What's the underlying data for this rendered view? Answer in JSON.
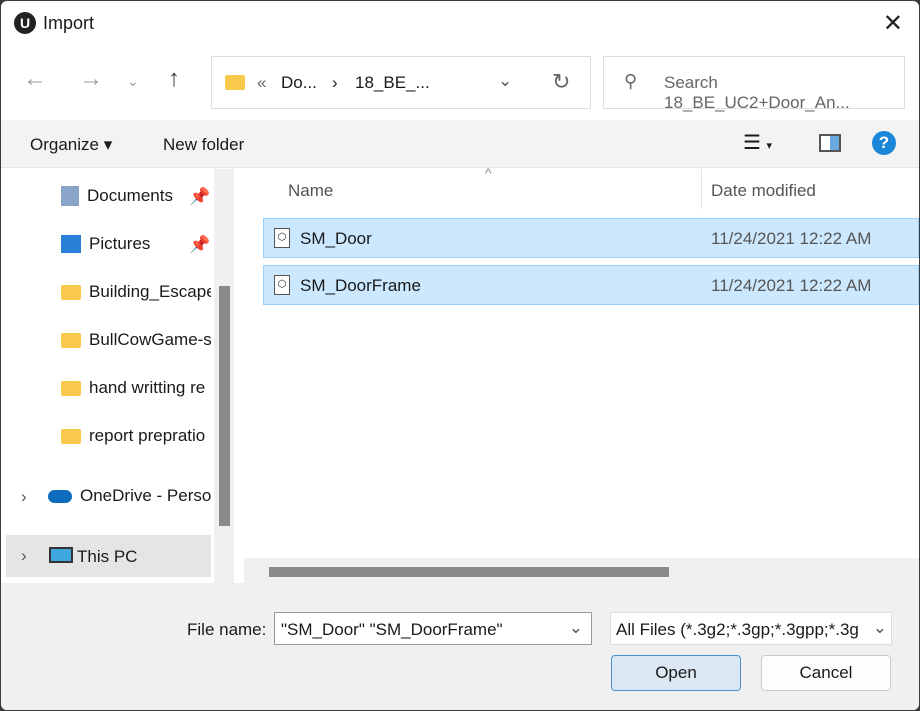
{
  "window": {
    "title": "Import"
  },
  "address": {
    "segments": [
      "Do...",
      "18_BE_..."
    ]
  },
  "search": {
    "placeholder": "Search 18_BE_UC2+Door_An..."
  },
  "toolbar": {
    "organize": "Organize",
    "new_folder": "New folder"
  },
  "sidebar": {
    "items": [
      {
        "label": "Documents",
        "icon": "documents-icon"
      },
      {
        "label": "Pictures",
        "icon": "pictures-icon"
      },
      {
        "label": "Building_Escape",
        "icon": "folder-icon"
      },
      {
        "label": "BullCowGame-s",
        "icon": "folder-icon"
      },
      {
        "label": "hand writting re",
        "icon": "folder-icon"
      },
      {
        "label": "report prepratio",
        "icon": "folder-icon"
      },
      {
        "label": "OneDrive - Perso",
        "icon": "onedrive-icon"
      },
      {
        "label": "This PC",
        "icon": "pc-icon"
      }
    ]
  },
  "columns": {
    "name": "Name",
    "date": "Date modified"
  },
  "files": [
    {
      "name": "SM_Door",
      "date": "11/24/2021 12:22 AM"
    },
    {
      "name": "SM_DoorFrame",
      "date": "11/24/2021 12:22 AM"
    }
  ],
  "footer": {
    "file_name_label": "File name:",
    "file_name_value": "\"SM_Door\" \"SM_DoorFrame\"",
    "file_type": "All Files (*.3g2;*.3gp;*.3gpp;*.3g",
    "open": "Open",
    "cancel": "Cancel"
  }
}
